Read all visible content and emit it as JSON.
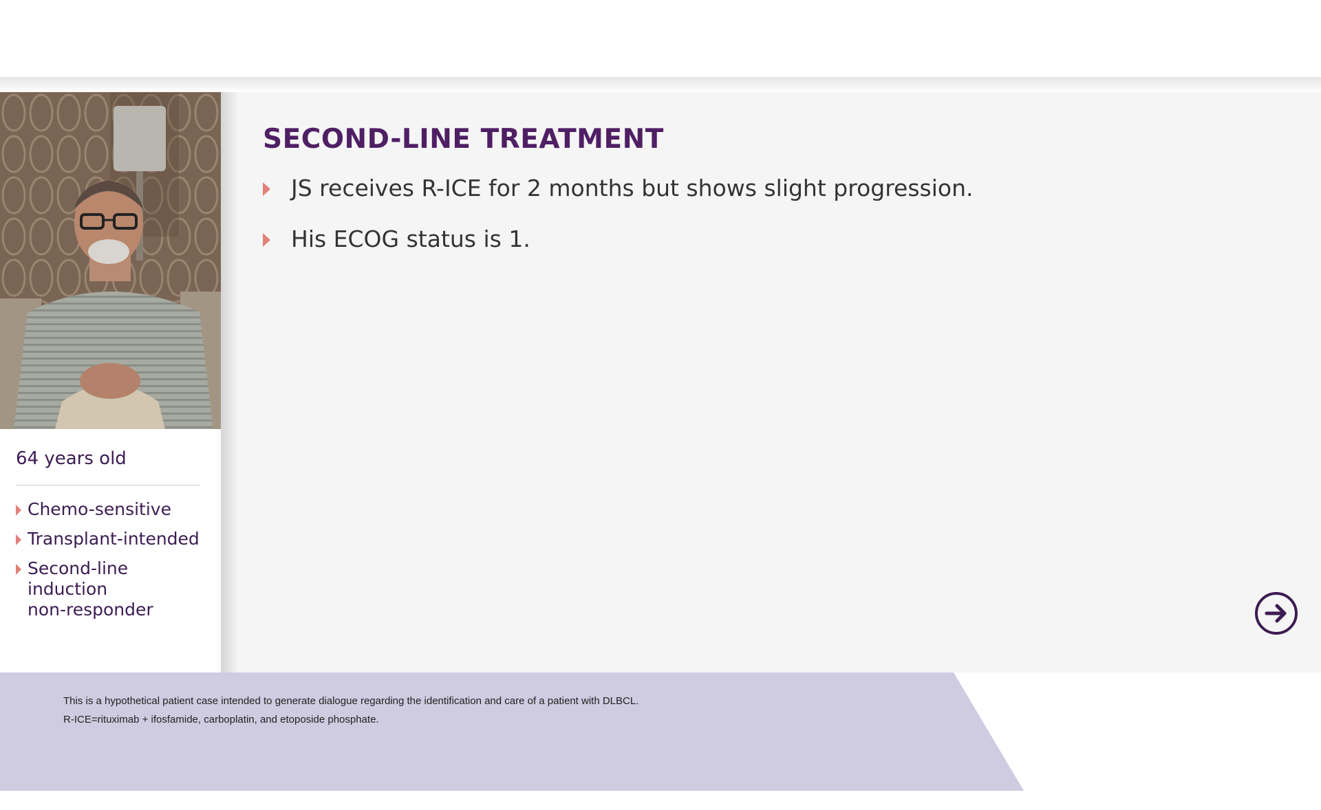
{
  "slide": {
    "title": "SECOND-LINE TREATMENT",
    "bullets": [
      "JS receives R-ICE for 2 months but shows slight progression.",
      "His ECOG status is 1."
    ]
  },
  "patient": {
    "photo_icon": "patient-photo",
    "age": "64 years old",
    "traits": [
      "Chemo-sensitive",
      "Transplant-intended",
      "Second-line\ninduction\nnon-responder"
    ]
  },
  "navigation": {
    "next_icon": "arrow-right-circle-icon"
  },
  "footer": {
    "lines": [
      "This is a hypothetical patient case intended to generate dialogue regarding the identification and care of a patient with DLBCL.",
      "R-ICE=rituximab + ifosfamide, carboplatin, and etoposide phosphate."
    ]
  },
  "colors": {
    "title_purple": "#4f1f64",
    "accent_salmon": "#e2807a",
    "footer_lavender": "#cfcbe0",
    "panel_gray": "#f5f5f5"
  }
}
